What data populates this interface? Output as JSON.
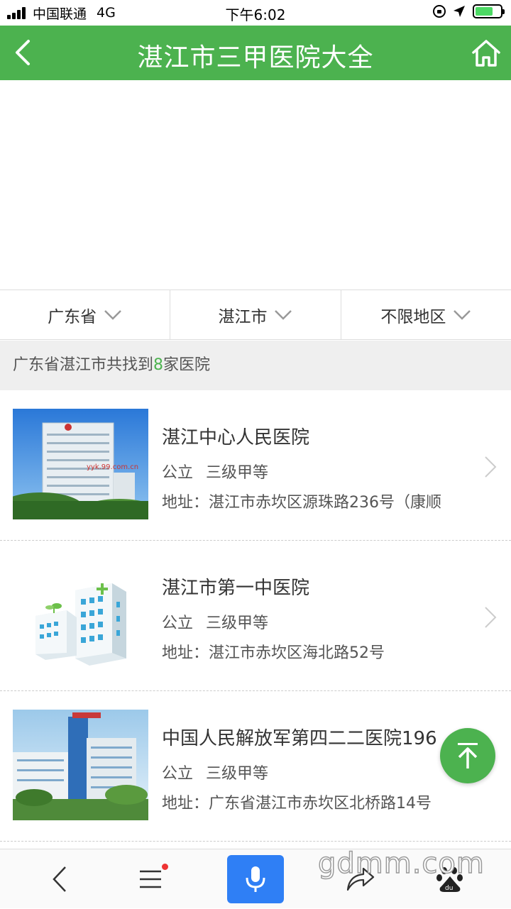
{
  "status_bar": {
    "carrier": "中国联通",
    "network": "4G",
    "time": "下午6:02"
  },
  "header": {
    "title": "湛江市三甲医院大全",
    "back_icon": "chevron-left-icon",
    "home_icon": "home-icon"
  },
  "filters": [
    {
      "label": "广东省"
    },
    {
      "label": "湛江市"
    },
    {
      "label": "不限地区"
    }
  ],
  "result": {
    "prefix": "广东省湛江市共找到",
    "count": "8",
    "suffix": "家医院"
  },
  "hospitals": [
    {
      "name": "湛江中心人民医院",
      "type": "公立",
      "level": "三级甲等",
      "address": "地址：湛江市赤坎区源珠路236号（康顺",
      "thumb_text": "yyk.99.com.cn"
    },
    {
      "name": "湛江市第一中医院",
      "type": "公立",
      "level": "三级甲等",
      "address": "地址：湛江市赤坎区海北路52号"
    },
    {
      "name": "中国人民解放军第四二二医院196",
      "type": "公立",
      "level": "三级甲等",
      "address": "地址：广东省湛江市赤坎区北桥路14号"
    }
  ],
  "bottom_bar": {
    "icons": [
      "back-icon",
      "menu-icon",
      "microphone-icon",
      "share-icon",
      "baidu-icon"
    ],
    "watermark": "gdmm.com"
  },
  "colors": {
    "brand_green": "#4cb24f",
    "mic_blue": "#2f7ff5",
    "notification_red": "#e33333"
  }
}
